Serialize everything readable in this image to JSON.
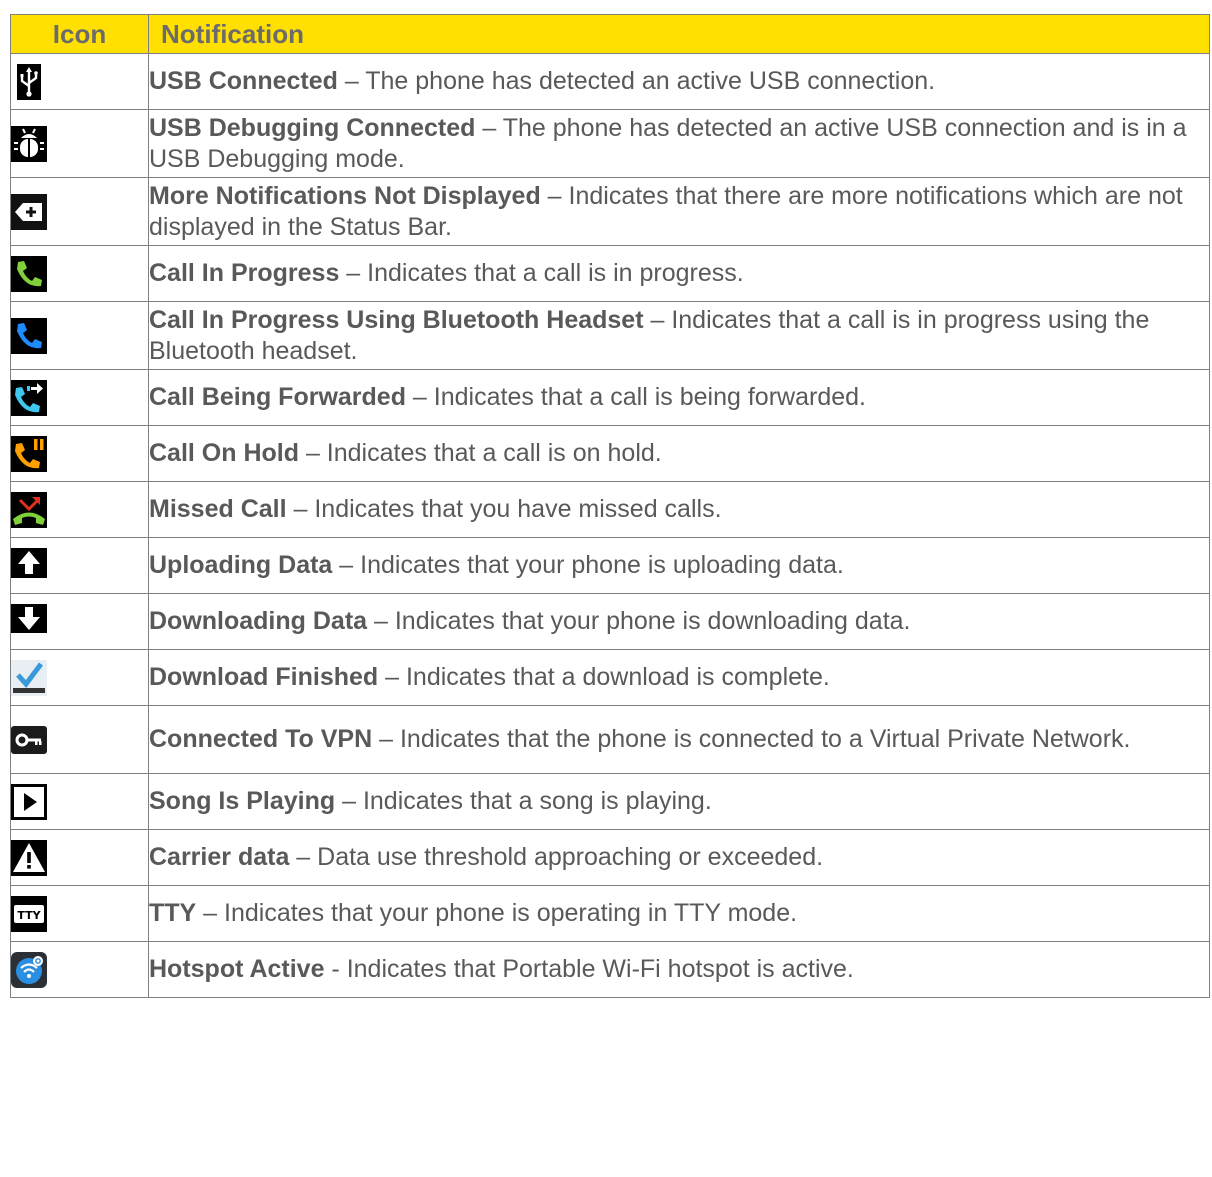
{
  "header": {
    "icon_col": "Icon",
    "notification_col": "Notification"
  },
  "rows": [
    {
      "icon": "usb-icon",
      "title": "USB Connected",
      "sep": " – ",
      "desc": "The phone has detected an active USB connection."
    },
    {
      "icon": "usb-debugging-icon",
      "title": "USB Debugging Connected",
      "sep": " – ",
      "desc": "The phone has detected an active USB connection and is in a USB Debugging mode."
    },
    {
      "icon": "more-notifications-icon",
      "title": "More Notifications Not Displayed",
      "sep": " – ",
      "desc": "Indicates that there are more notifications which are not displayed in the Status Bar."
    },
    {
      "icon": "call-in-progress-icon",
      "title": "Call In Progress",
      "sep": " – ",
      "desc": "Indicates that a call is in progress."
    },
    {
      "icon": "call-bluetooth-icon",
      "title": "Call In Progress Using Bluetooth Headset",
      "sep": " – ",
      "desc": "Indicates that a call is in progress using the Bluetooth headset."
    },
    {
      "icon": "call-forwarded-icon",
      "title": "Call Being Forwarded",
      "sep": " – ",
      "desc": "Indicates that a call is being forwarded."
    },
    {
      "icon": "call-on-hold-icon",
      "title": "Call On Hold",
      "sep": " – ",
      "desc": "Indicates that a call is on hold."
    },
    {
      "icon": "missed-call-icon",
      "title": "Missed Call",
      "sep": " – ",
      "desc": "Indicates that you have missed calls."
    },
    {
      "icon": "upload-icon",
      "title": "Uploading Data",
      "sep": " – ",
      "desc": "Indicates that your phone is uploading data."
    },
    {
      "icon": "download-icon",
      "title": "Downloading Data",
      "sep": " – ",
      "desc": "Indicates that your phone is downloading data."
    },
    {
      "icon": "download-finished-icon",
      "title": "Download Finished",
      "sep": " – ",
      "desc": "Indicates that a download is complete."
    },
    {
      "icon": "vpn-key-icon",
      "title": "Connected To VPN",
      "sep": " – ",
      "desc": "Indicates that the phone is connected to a Virtual Private Network."
    },
    {
      "icon": "play-icon",
      "title": "Song Is Playing",
      "sep": " – ",
      "desc": "Indicates that a song is playing."
    },
    {
      "icon": "warning-icon",
      "title": "Carrier data",
      "sep": " – ",
      "desc": "Data use threshold approaching or exceeded."
    },
    {
      "icon": "tty-icon",
      "title": "TTY",
      "sep": " – ",
      "desc": "Indicates that your phone is operating in TTY mode.",
      "icon_text": "TTY"
    },
    {
      "icon": "hotspot-icon",
      "title": "Hotspot Active",
      "sep": " - ",
      "desc": "Indicates that Portable Wi-Fi hotspot is active."
    }
  ],
  "colors": {
    "header_bg": "#ffe000",
    "call_green": "#7fd03a",
    "call_blue": "#1e8cff",
    "call_cyan": "#3ec8f0",
    "call_orange": "#ffa000",
    "missed_red": "#e0301e",
    "check_blue": "#3a9ad9",
    "hotspot_blue": "#2a8fe0"
  }
}
